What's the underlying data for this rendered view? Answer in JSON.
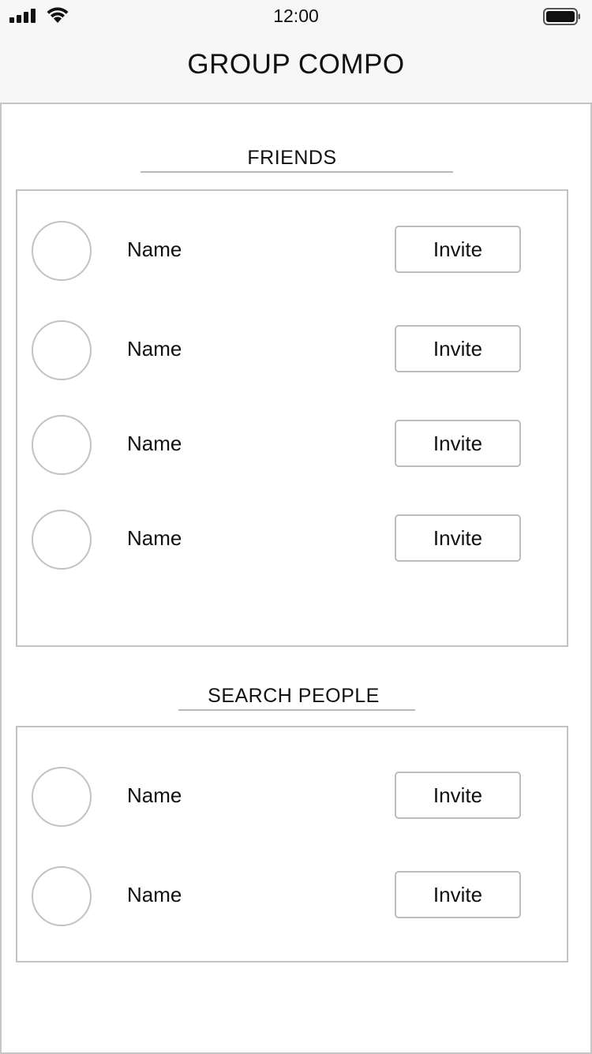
{
  "status_bar": {
    "time": "12:00",
    "signal_icon": "cellular-signal-icon",
    "wifi_icon": "wifi-icon",
    "battery_icon": "battery-icon"
  },
  "header": {
    "title": "GROUP COMPO"
  },
  "friends": {
    "heading": "FRIENDS",
    "items": [
      {
        "name": "Name",
        "invite_label": "Invite"
      },
      {
        "name": "Name",
        "invite_label": "Invite"
      },
      {
        "name": "Name",
        "invite_label": "Invite"
      },
      {
        "name": "Name",
        "invite_label": "Invite"
      }
    ]
  },
  "search_people": {
    "heading": "SEARCH PEOPLE",
    "items": [
      {
        "name": "Name",
        "invite_label": "Invite"
      },
      {
        "name": "Name",
        "invite_label": "Invite"
      }
    ]
  },
  "colors": {
    "header_bg": "#f7f7f7",
    "border": "#c2c2c2",
    "text": "#111111"
  }
}
